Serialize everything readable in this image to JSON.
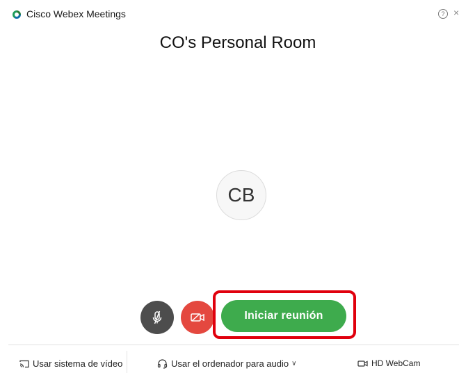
{
  "window": {
    "title": "Cisco Webex Meetings",
    "help_glyph": "?",
    "close_glyph": "×"
  },
  "room": {
    "title": "CO's Personal Room",
    "avatar_initials": "CB"
  },
  "controls": {
    "start_label": "Iniciar reunión"
  },
  "footer": {
    "video_system_label": "Usar sistema de vídeo",
    "audio_label": "Usar el ordenador para audio",
    "chevron_glyph": "∨",
    "camera_label": "HD WebCam"
  },
  "colors": {
    "start_button": "#3eab4d",
    "video_button": "#e4483f",
    "mute_button": "#4d4d4d",
    "highlight": "#e0000d"
  },
  "icons": {
    "logo": "webex-logo-icon",
    "help": "help-icon",
    "close": "close-icon",
    "mute": "microphone-muted-icon",
    "video": "video-off-icon",
    "video_system": "cast-icon",
    "audio": "headset-icon",
    "camera": "camera-icon"
  }
}
